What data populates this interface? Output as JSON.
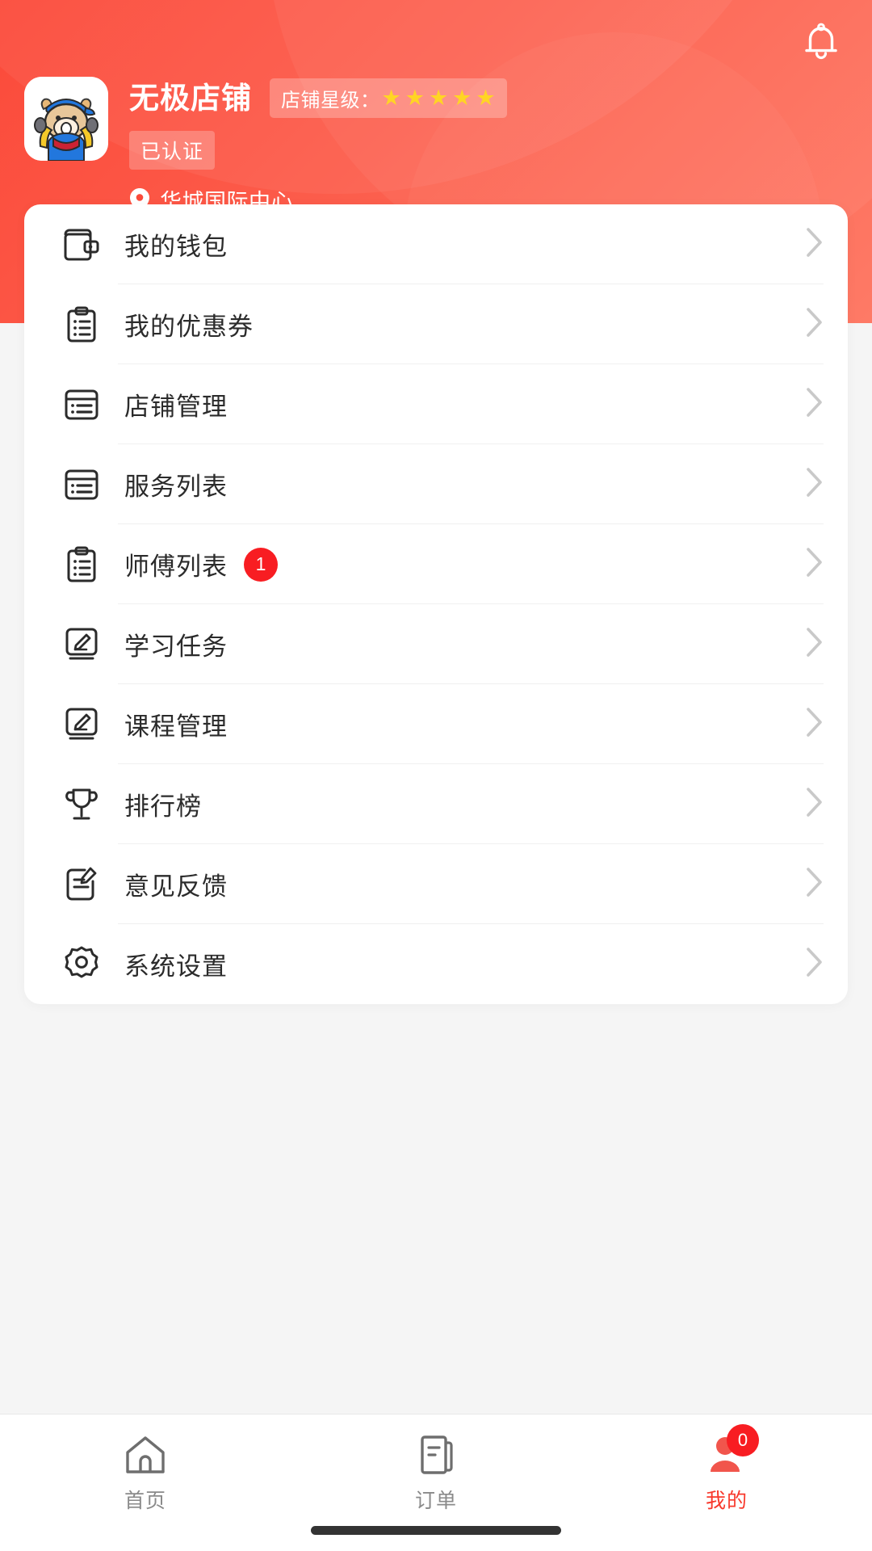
{
  "theme": {
    "brand_red": "#fb4a3a",
    "accent_red": "#f8392c",
    "badge_red": "#f81d22",
    "star_gold": "#ffd524",
    "page_bg": "#f5f5f5",
    "card_bg": "#ffffff",
    "text_primary": "#2b2b2b",
    "text_muted": "#8a8a8a"
  },
  "header": {
    "notification_icon": "bell-icon",
    "avatar_icon": "cow-mascot-avatar",
    "shop_name": "无极店铺",
    "star_rating": {
      "label": "店铺星级：",
      "filled": 5,
      "total": 5,
      "star_glyph": "★"
    },
    "verified_badge": "已认证",
    "location_icon": "location-pin-icon",
    "location": "华城国际中心"
  },
  "menu": {
    "items": [
      {
        "label": "我的钱包",
        "icon": "wallet-icon",
        "badge": null
      },
      {
        "label": "我的优惠券",
        "icon": "coupon-list-icon",
        "badge": null
      },
      {
        "label": "店铺管理",
        "icon": "window-list-icon",
        "badge": null
      },
      {
        "label": "服务列表",
        "icon": "window-list-icon",
        "badge": null
      },
      {
        "label": "师傅列表",
        "icon": "clipboard-list-icon",
        "badge": "1"
      },
      {
        "label": "学习任务",
        "icon": "edit-board-icon",
        "badge": null
      },
      {
        "label": "课程管理",
        "icon": "edit-board-icon",
        "badge": null
      },
      {
        "label": "排行榜",
        "icon": "trophy-icon",
        "badge": null
      },
      {
        "label": "意见反馈",
        "icon": "feedback-edit-icon",
        "badge": null
      },
      {
        "label": "系统设置",
        "icon": "gear-icon",
        "badge": null
      }
    ],
    "chevron_icon": "chevron-right-icon"
  },
  "tabbar": {
    "tabs": [
      {
        "label": "首页",
        "icon": "home-icon",
        "active": false,
        "badge": null
      },
      {
        "label": "订单",
        "icon": "document-icon",
        "active": false,
        "badge": null
      },
      {
        "label": "我的",
        "icon": "person-icon",
        "active": true,
        "badge": "0"
      }
    ]
  }
}
